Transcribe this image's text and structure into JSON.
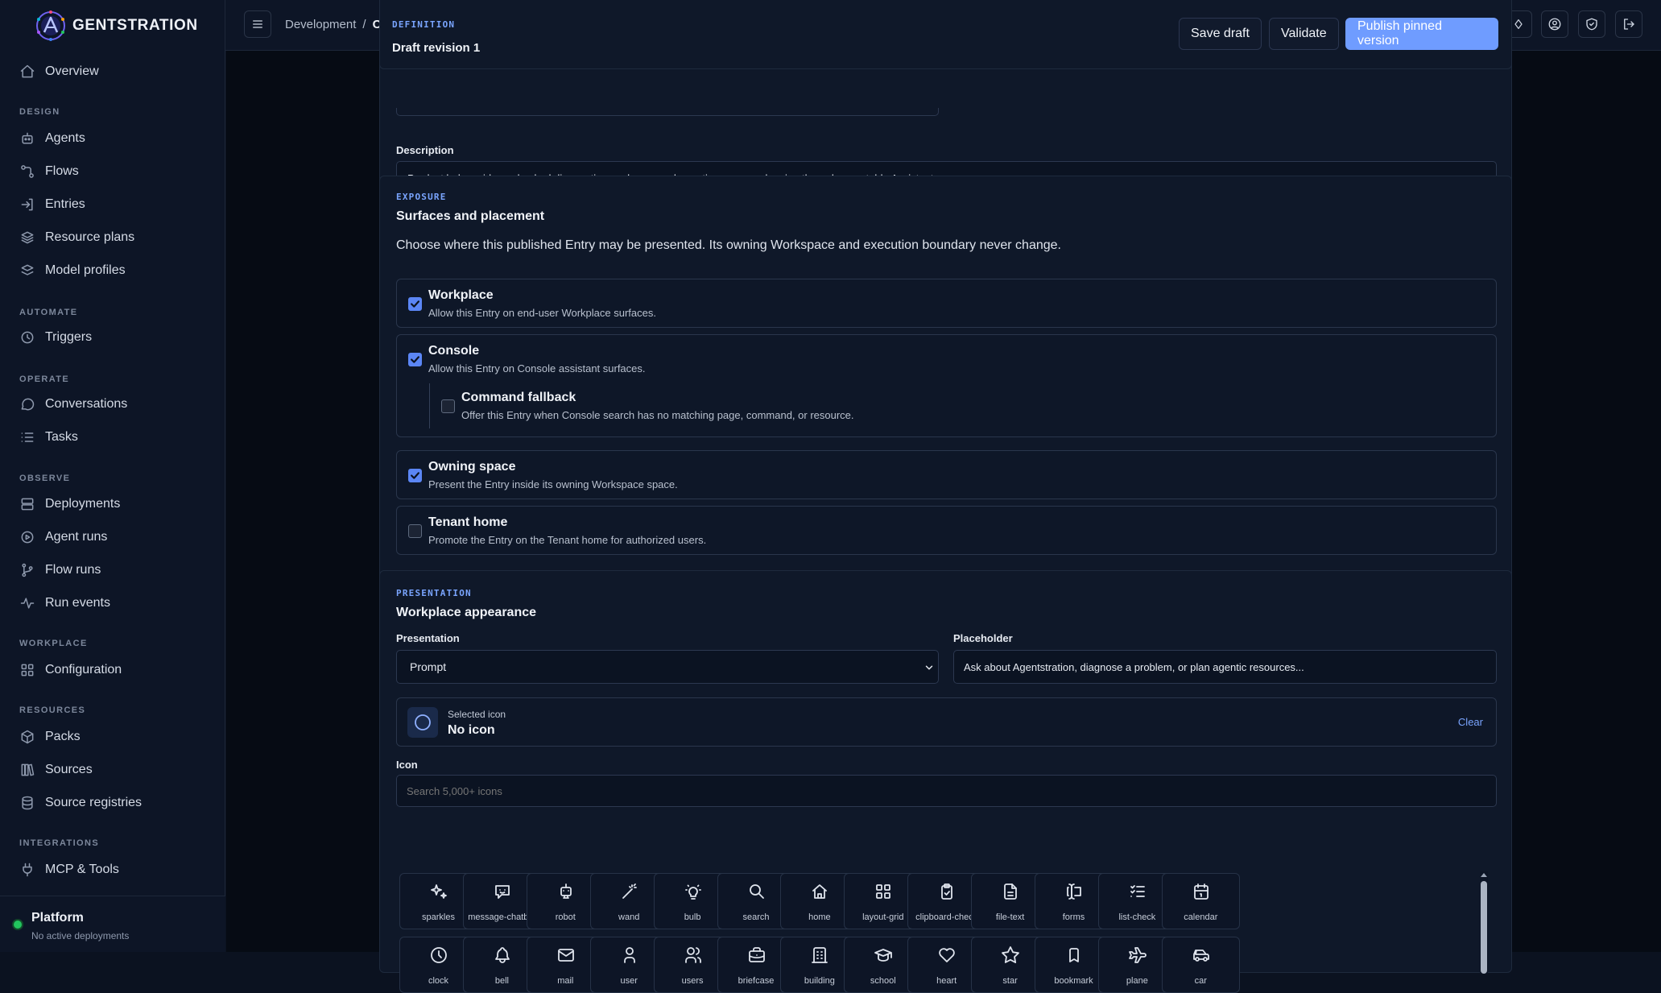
{
  "brand": {
    "name": "GENTSTRATION"
  },
  "sidebar": {
    "overview": "Overview",
    "sections": {
      "design": "DESIGN",
      "automate": "AUTOMATE",
      "operate": "OPERATE",
      "observe": "OBSERVE",
      "workplace": "WORKPLACE",
      "resources": "RESOURCES",
      "integrations": "INTEGRATIONS"
    },
    "items": {
      "agents": "Agents",
      "flows": "Flows",
      "entries": "Entries",
      "resource_plans": "Resource plans",
      "model_profiles": "Model profiles",
      "triggers": "Triggers",
      "conversations": "Conversations",
      "tasks": "Tasks",
      "deployments": "Deployments",
      "agent_runs": "Agent runs",
      "flow_runs": "Flow runs",
      "run_events": "Run events",
      "configuration": "Configuration",
      "packs": "Packs",
      "sources": "Sources",
      "source_registries": "Source registries",
      "mcp_tools": "MCP & Tools"
    },
    "platform": {
      "name": "Platform",
      "status": "No active deployments",
      "status_color": "#22c55e"
    }
  },
  "topbar": {
    "breadcrumb": [
      "Development",
      "/",
      "Co"
    ]
  },
  "definition": {
    "eyebrow": "DEFINITION",
    "title": "Draft revision 1",
    "save_label": "Save draft",
    "validate_label": "Validate",
    "publish_label": "Publish pinned version",
    "description_label": "Description",
    "description_value": "Product help, evidence-backed diagnostics, and governed agentic resource planning through one stable Assistant."
  },
  "exposure": {
    "eyebrow": "EXPOSURE",
    "title": "Surfaces and placement",
    "intro": "Choose where this published Entry may be presented. Its owning Workspace and execution boundary never change.",
    "workplace": {
      "title": "Workplace",
      "desc": "Allow this Entry on end-user Workplace surfaces.",
      "checked": true
    },
    "console": {
      "title": "Console",
      "desc": "Allow this Entry on Console assistant surfaces.",
      "checked": true
    },
    "command_fallback": {
      "title": "Command fallback",
      "desc": "Offer this Entry when Console search has no matching page, command, or resource.",
      "checked": false
    },
    "owning_space": {
      "title": "Owning space",
      "desc": "Present the Entry inside its owning Workspace space.",
      "checked": true
    },
    "tenant_home": {
      "title": "Tenant home",
      "desc": "Promote the Entry on the Tenant home for authorized users.",
      "checked": false
    }
  },
  "presentation": {
    "eyebrow": "PRESENTATION",
    "title": "Workplace appearance",
    "presentation_label": "Presentation",
    "presentation_value": "Prompt",
    "placeholder_label": "Placeholder",
    "placeholder_value": "Ask about Agentstration, diagnose a problem, or plan agentic resources...",
    "selected_icon_caption": "Selected icon",
    "selected_icon_value": "No icon",
    "clear_label": "Clear",
    "icon_label": "Icon",
    "icon_search_placeholder": "Search 5,000+ icons",
    "icons_row1": [
      "sparkles",
      "message-chatbot",
      "robot",
      "wand",
      "bulb",
      "search",
      "home",
      "layout-grid",
      "clipboard-check",
      "file-text",
      "forms",
      "list-check",
      "calendar"
    ],
    "icons_row2": [
      "clock",
      "bell",
      "mail",
      "user",
      "users",
      "briefcase",
      "building",
      "school",
      "heart",
      "star",
      "bookmark",
      "plane",
      "car"
    ]
  },
  "colors": {
    "accent": "#6f9cff",
    "checkbox": "#5b86f5",
    "background": "#060b14",
    "panel": "#0f1829"
  }
}
